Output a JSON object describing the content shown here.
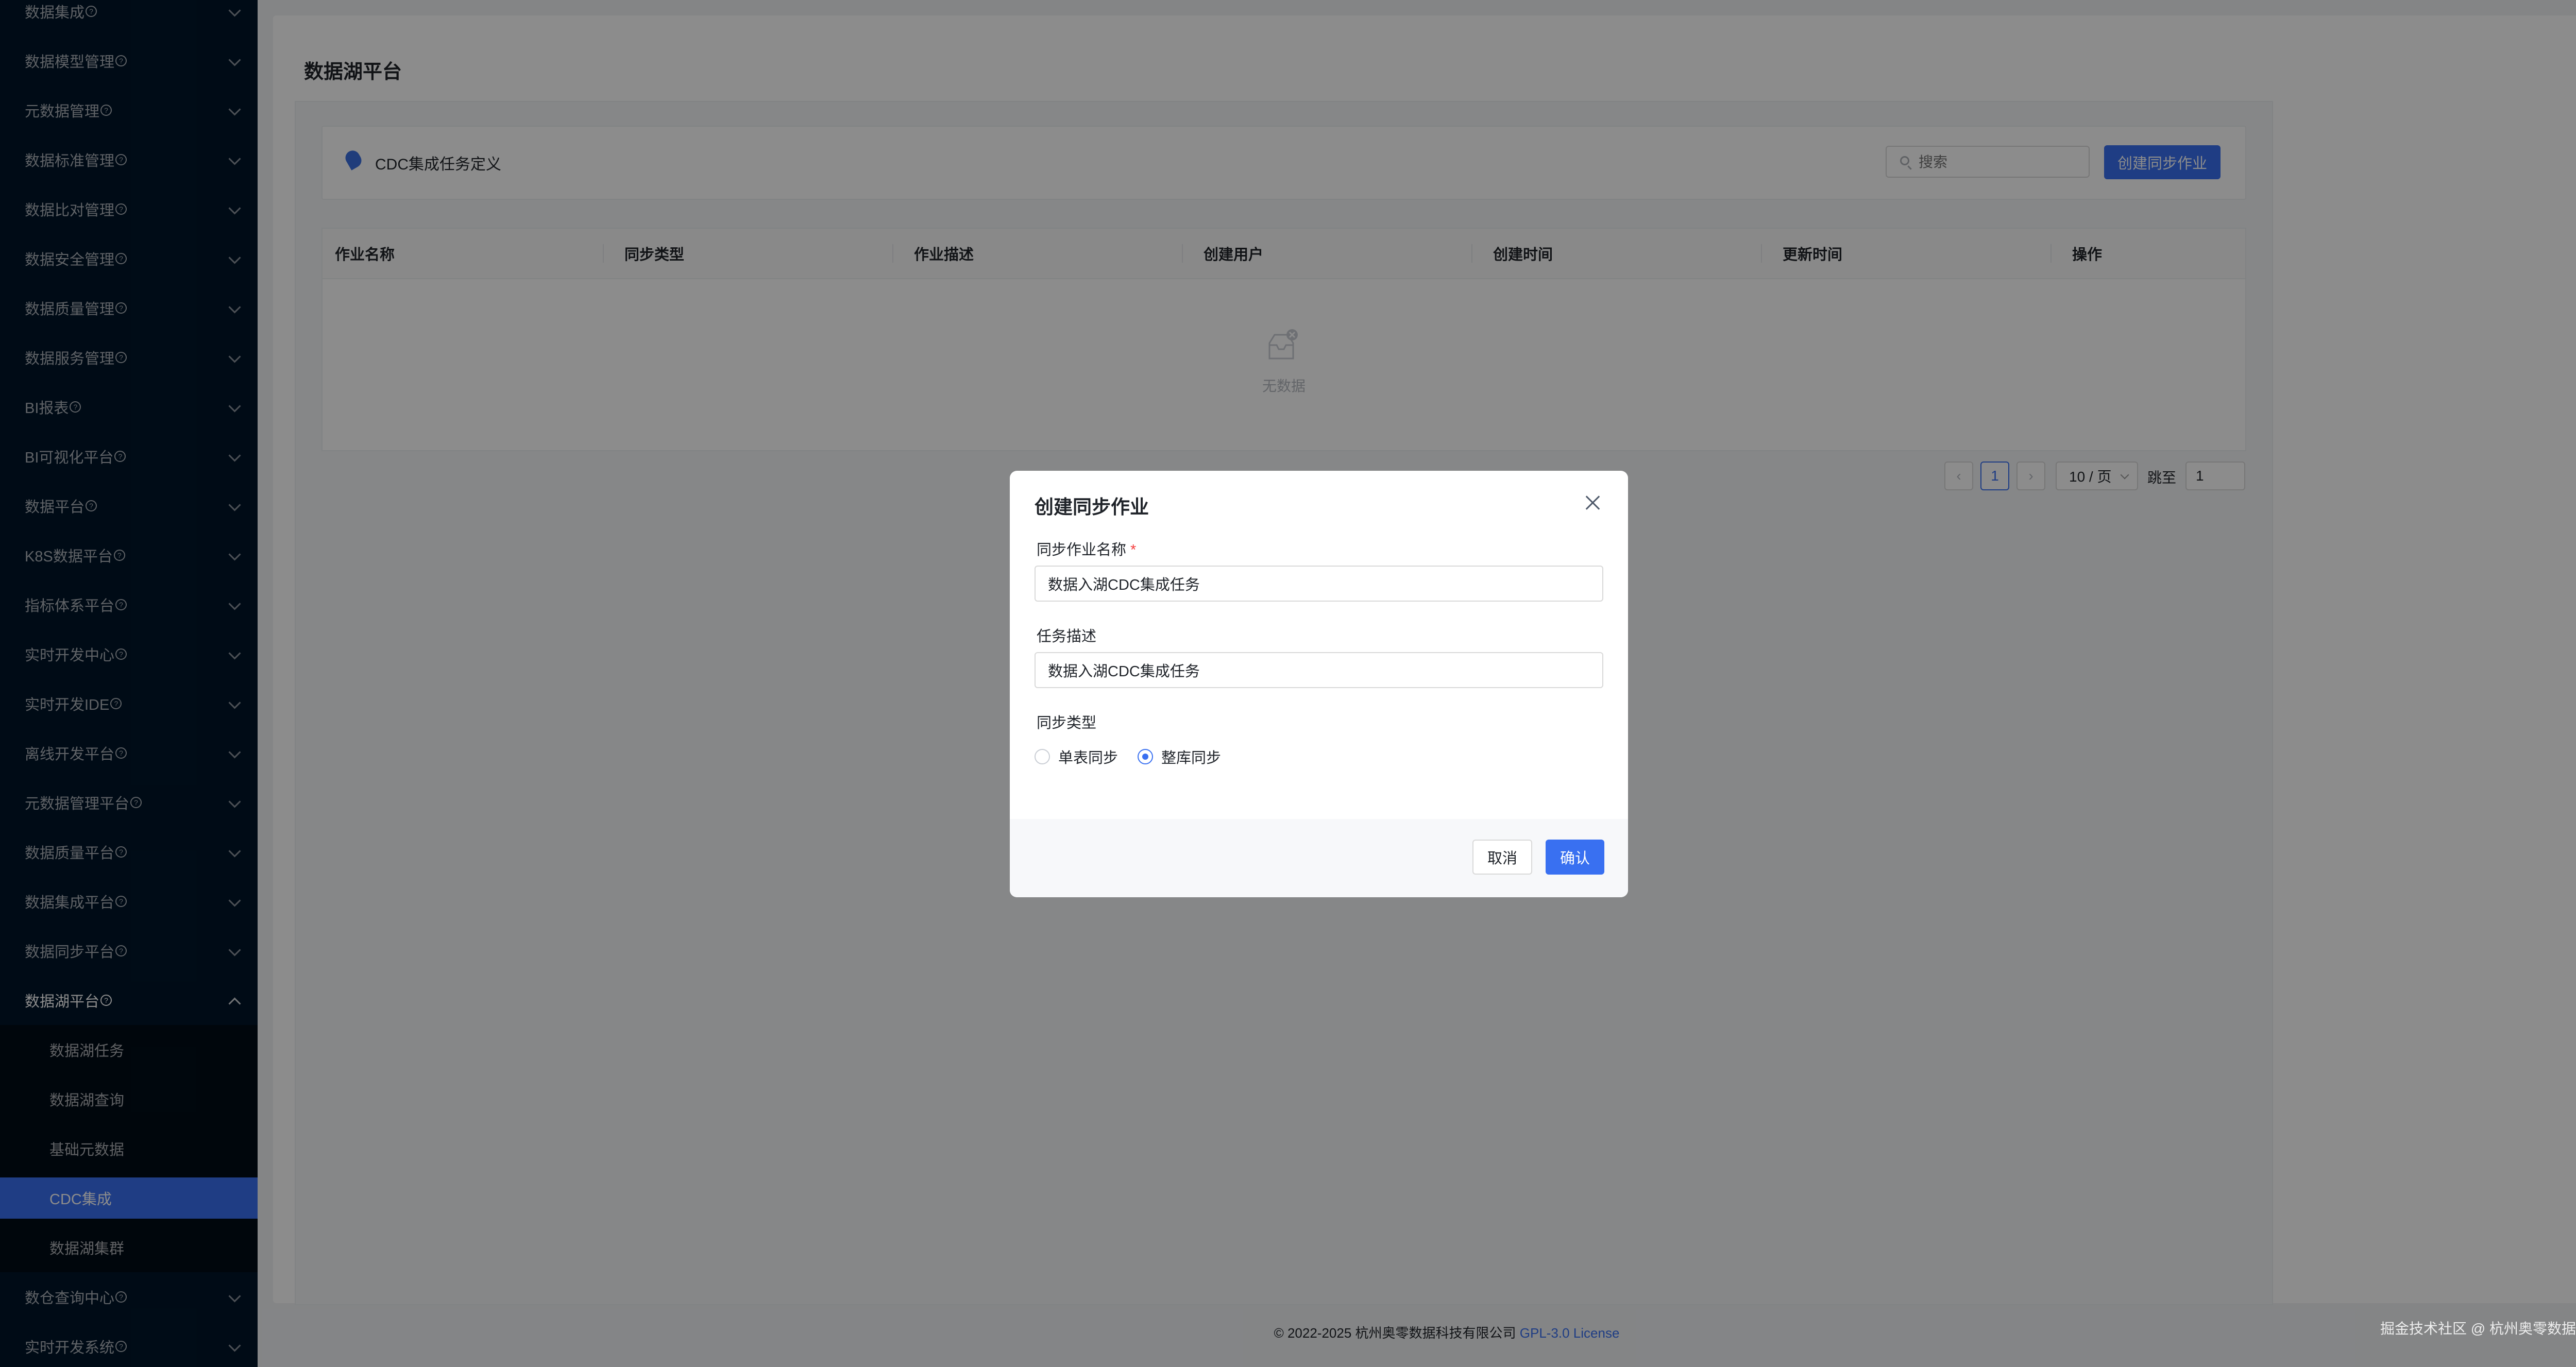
{
  "sidebar": {
    "items": [
      {
        "label": "数据集成"
      },
      {
        "label": "数据模型管理"
      },
      {
        "label": "元数据管理"
      },
      {
        "label": "数据标准管理"
      },
      {
        "label": "数据比对管理"
      },
      {
        "label": "数据安全管理"
      },
      {
        "label": "数据质量管理"
      },
      {
        "label": "数据服务管理"
      },
      {
        "label": "BI报表"
      },
      {
        "label": "BI可视化平台"
      },
      {
        "label": "数据平台"
      },
      {
        "label": "K8S数据平台"
      },
      {
        "label": "指标体系平台"
      },
      {
        "label": "实时开发中心"
      },
      {
        "label": "实时开发IDE"
      },
      {
        "label": "离线开发平台"
      },
      {
        "label": "元数据管理平台"
      },
      {
        "label": "数据质量平台"
      },
      {
        "label": "数据集成平台"
      },
      {
        "label": "数据同步平台"
      },
      {
        "label": "数据湖平台"
      }
    ],
    "submenu": [
      {
        "label": "数据湖任务"
      },
      {
        "label": "数据湖查询"
      },
      {
        "label": "基础元数据"
      },
      {
        "label": "CDC集成"
      },
      {
        "label": "数据湖集群"
      }
    ],
    "bottom_items": [
      {
        "label": "数仓查询中心"
      },
      {
        "label": "实时开发系统"
      }
    ]
  },
  "page": {
    "title": "数据湖平台",
    "section_title": "CDC集成任务定义",
    "search_placeholder": "搜索",
    "create_button": "创建同步作业"
  },
  "table": {
    "columns": [
      "作业名称",
      "同步类型",
      "作业描述",
      "创建用户",
      "创建时间",
      "更新时间",
      "操作"
    ],
    "empty_text": "无数据"
  },
  "pagination": {
    "prev": "‹",
    "current_page": "1",
    "next": "›",
    "page_size": "10 / 页",
    "jump_label": "跳至",
    "jump_value": "1"
  },
  "footer": {
    "copyright": "© 2022-2025 杭州奥零数据科技有限公司",
    "license": "GPL-3.0 License",
    "watermark": "掘金技术社区 @ 杭州奥零数据科技"
  },
  "modal": {
    "title": "创建同步作业",
    "name_label": "同步作业名称",
    "name_required": "*",
    "name_value": "数据入湖CDC集成任务",
    "desc_label": "任务描述",
    "desc_value": "数据入湖CDC集成任务",
    "type_label": "同步类型",
    "radio_single": "单表同步",
    "radio_whole": "整库同步",
    "selected_type": "整库同步",
    "cancel": "取消",
    "confirm": "确认"
  },
  "colors": {
    "primary": "#3970f1",
    "sidebar_bg": "#001529",
    "required": "#f53f3f"
  }
}
